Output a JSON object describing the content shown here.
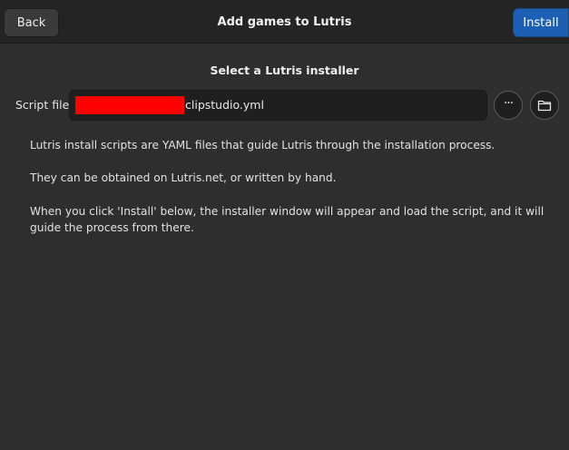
{
  "header": {
    "back_label": "Back",
    "title": "Add games to Lutris",
    "install_label": "Install"
  },
  "main": {
    "subtitle": "Select a Lutris installer",
    "script_file": {
      "label": "Script file",
      "value": "clipstudio.yml"
    },
    "browse_icon": "ellipsis-icon",
    "folder_icon": "folder-icon",
    "paragraphs": [
      "Lutris install scripts are YAML files that guide Lutris through the installation process.",
      "They can be obtained on Lutris.net, or written by hand.",
      "When you click 'Install' below, the installer window will appear and load the script, and it will guide the process from there."
    ]
  },
  "colors": {
    "accent": "#1c5fb5",
    "background": "#2e2e2e",
    "headerbar": "#242424",
    "redaction": "#ff0000"
  }
}
